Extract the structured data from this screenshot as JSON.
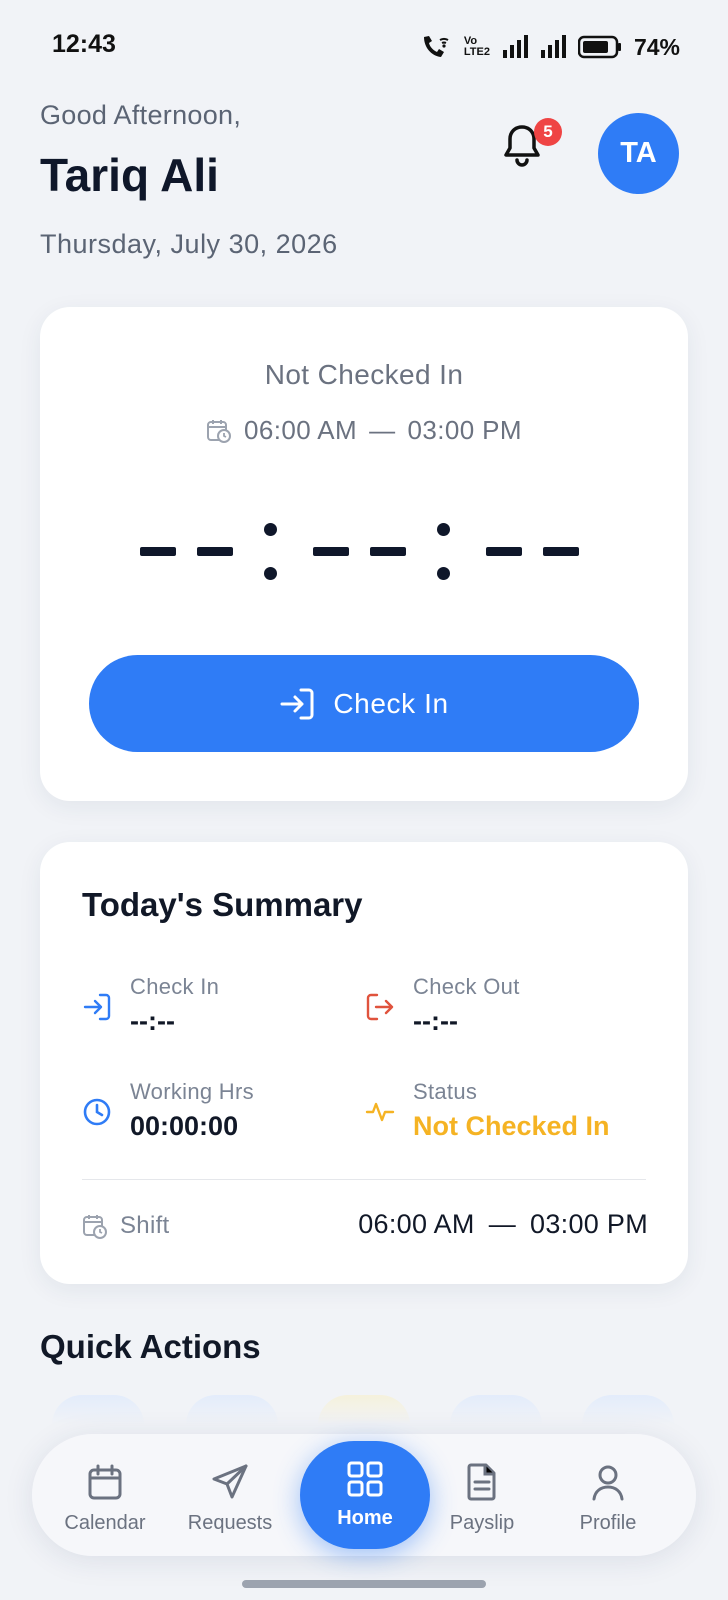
{
  "status_bar": {
    "time": "12:43",
    "volte_top": "Vo",
    "volte_bottom": "LTE2",
    "battery_pct": "74%"
  },
  "header": {
    "greeting": "Good Afternoon,",
    "name": "Tariq Ali",
    "date": "Thursday, July 30, 2026",
    "notification_count": "5",
    "avatar_initials": "TA"
  },
  "checkin_card": {
    "status": "Not Checked In",
    "shift_start": "06:00 AM",
    "shift_separator": "—",
    "shift_end": "03:00 PM",
    "timer": "--:--:--",
    "button_label": "Check In"
  },
  "summary": {
    "title": "Today's Summary",
    "check_in_label": "Check In",
    "check_in_value": "--:--",
    "check_out_label": "Check Out",
    "check_out_value": "--:--",
    "working_hrs_label": "Working Hrs",
    "working_hrs_value": "00:00:00",
    "status_label": "Status",
    "status_value": "Not Checked In",
    "shift_label": "Shift",
    "shift_start": "06:00 AM",
    "shift_separator": "—",
    "shift_end": "03:00 PM"
  },
  "quick_actions": {
    "title": "Quick Actions"
  },
  "nav": {
    "calendar": "Calendar",
    "requests": "Requests",
    "home": "Home",
    "payslip": "Payslip",
    "profile": "Profile"
  },
  "colors": {
    "accent": "#2f7cf6",
    "checkout": "#e0533d",
    "status_warn": "#f5b323",
    "badge": "#ef4444"
  }
}
